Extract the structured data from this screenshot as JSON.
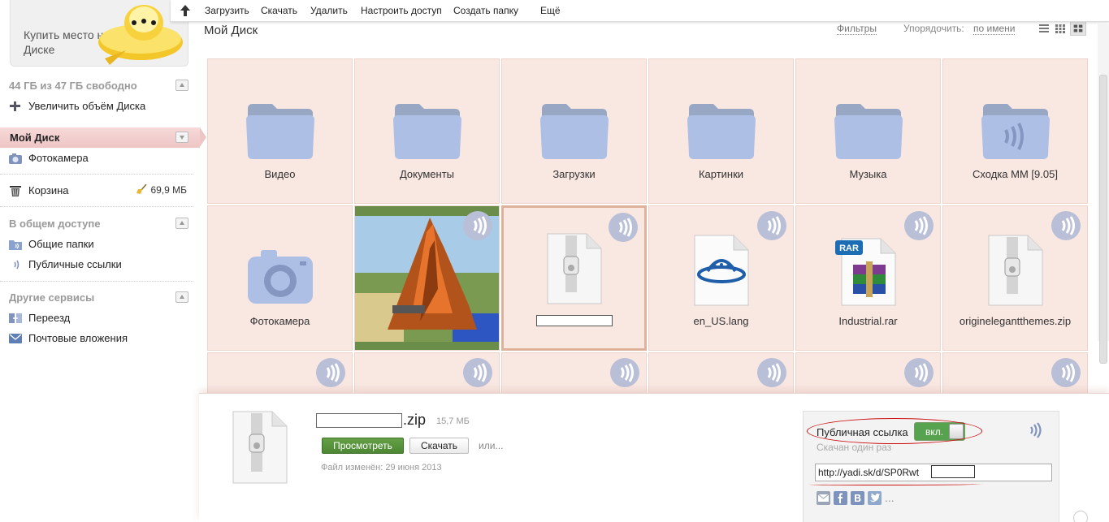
{
  "toolbar": {
    "upload": "Загрузить",
    "download": "Скачать",
    "delete": "Удалить",
    "access": "Настроить доступ",
    "new_folder": "Создать папку",
    "more": "Ещё"
  },
  "sidebar": {
    "promo": "Купить место на Диске",
    "quota": "44 ГБ из 47 ГБ свободно",
    "increase": "Увеличить объём Диска",
    "my_disk": "Мой Диск",
    "camera": "Фотокамера",
    "trash": "Корзина",
    "trash_size": "69,9 МБ",
    "shared_head": "В общем доступе",
    "shared_folders": "Общие папки",
    "public_links": "Публичные ссылки",
    "other_head": "Другие сервисы",
    "move": "Переезд",
    "mail_attachments": "Почтовые вложения"
  },
  "header": {
    "title": "Мой Диск",
    "filters": "Фильтры",
    "sort_label": "Упорядочить:",
    "sort_value": "по имени"
  },
  "tiles": [
    {
      "label": "Видео"
    },
    {
      "label": "Документы"
    },
    {
      "label": "Загрузки"
    },
    {
      "label": "Картинки"
    },
    {
      "label": "Музыка"
    },
    {
      "label": "Сходка ММ [9.05]"
    },
    {
      "label": "Фотокамера"
    },
    {
      "label": ""
    },
    {
      "label": ""
    },
    {
      "label": "en_US.lang"
    },
    {
      "label": "Industrial.rar"
    },
    {
      "label": "originelegantthemes.zip"
    }
  ],
  "details": {
    "ext": ".zip",
    "size": "15,7 МБ",
    "view_button": "Просмотреть",
    "download_button": "Скачать",
    "or_more": "или...",
    "modified": "Файл изменён: 29 июня 2013",
    "public_link_label": "Публичная ссылка",
    "switch_state": "вкл.",
    "downloads": "Скачан один раз",
    "link": "http://yadi.sk/d/SP0Rwt",
    "more_social": "..."
  },
  "colors": {
    "tile_bg": "#f9e7e2",
    "active_item": "#eec5c5",
    "view_button": "#4d8734",
    "switch_on": "#56a24e",
    "annotation_red": "#cc1111"
  }
}
